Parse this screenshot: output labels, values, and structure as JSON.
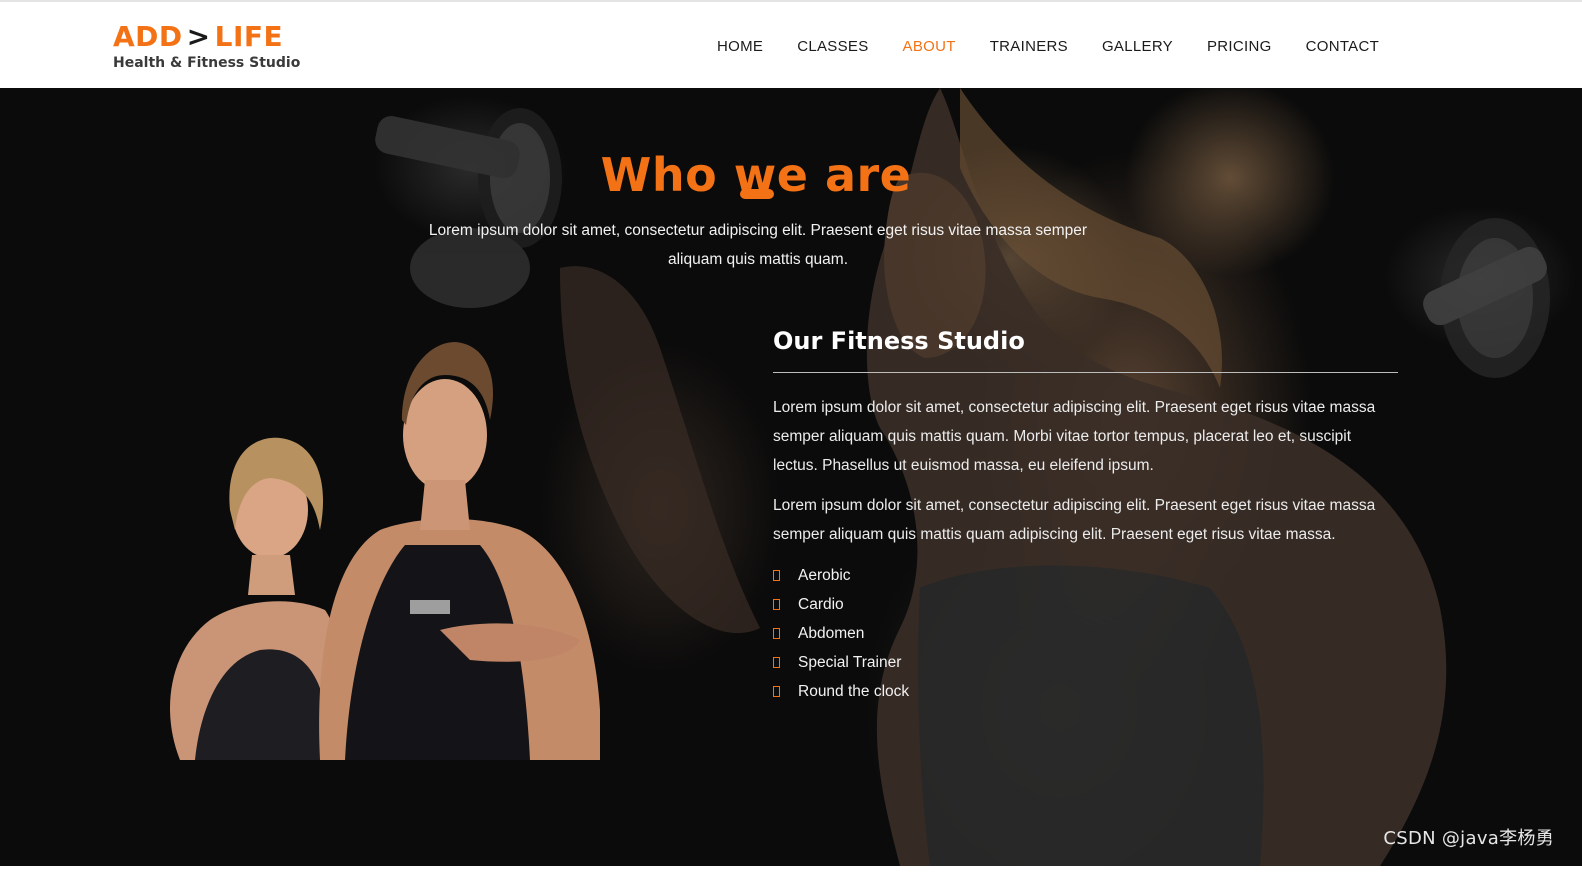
{
  "header": {
    "logo": {
      "part1": "ADD",
      "arrow": ">",
      "part2": "LIFE",
      "tagline": "Health & Fitness Studio"
    },
    "nav": [
      {
        "label": "HOME",
        "active": false
      },
      {
        "label": "CLASSES",
        "active": false
      },
      {
        "label": "ABOUT",
        "active": true
      },
      {
        "label": "TRAINERS",
        "active": false
      },
      {
        "label": "GALLERY",
        "active": false
      },
      {
        "label": "PRICING",
        "active": false
      },
      {
        "label": "CONTACT",
        "active": false
      }
    ]
  },
  "about": {
    "title": "Who we are",
    "intro": "Lorem ipsum dolor sit amet, consectetur adipiscing elit. Praesent eget risus vitae massa semper aliquam quis mattis quam.",
    "studio_title": "Our Fitness Studio",
    "paragraphs": [
      "Lorem ipsum dolor sit amet, consectetur adipiscing elit. Praesent eget risus vitae massa semper aliquam quis mattis quam. Morbi vitae tortor tempus, placerat leo et, suscipit lectus. Phasellus ut euismod massa, eu eleifend ipsum.",
      "Lorem ipsum dolor sit amet, consectetur adipiscing elit. Praesent eget risus vitae massa semper aliquam quis mattis quam adipiscing elit. Praesent eget risus vitae massa."
    ],
    "features": [
      "Aerobic",
      "Cardio",
      "Abdomen",
      "Special Trainer",
      "Round the clock"
    ]
  },
  "watermark": "CSDN @java李杨勇",
  "colors": {
    "accent": "#f47216",
    "nav_text": "#1b1b1b",
    "hero_bg": "#0b0b0b",
    "text_light": "#f2f2f2"
  },
  "icons": {
    "feature_bullet": "square-outline-icon"
  }
}
